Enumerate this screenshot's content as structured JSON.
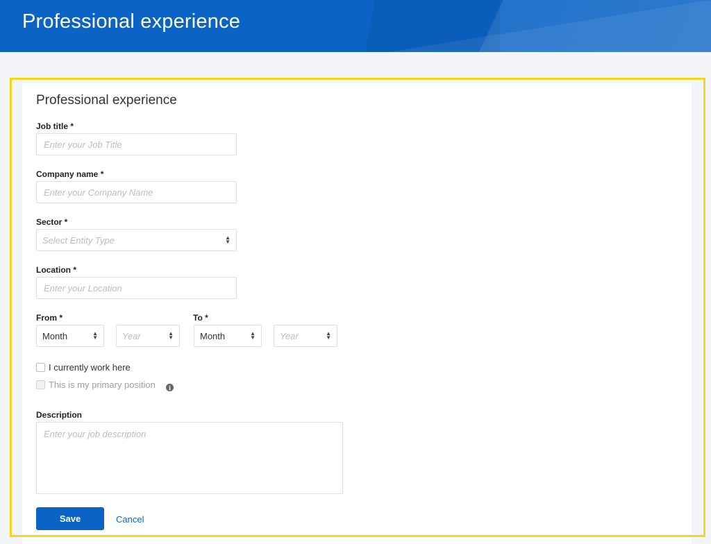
{
  "header": {
    "title": "Professional experience"
  },
  "form": {
    "title": "Professional experience",
    "job_title": {
      "label": "Job title *",
      "placeholder": "Enter your Job Title"
    },
    "company_name": {
      "label": "Company name *",
      "placeholder": "Enter your Company Name"
    },
    "sector": {
      "label": "Sector *",
      "placeholder": "Select Entity Type"
    },
    "location": {
      "label": "Location *",
      "placeholder": "Enter your Location"
    },
    "from": {
      "label": "From *",
      "month": "Month",
      "year_placeholder": "Year"
    },
    "to": {
      "label": "To *",
      "month": "Month",
      "year_placeholder": "Year"
    },
    "current_work": {
      "label": "I currently work here",
      "checked": false
    },
    "primary_position": {
      "label": "This is my primary position",
      "checked": false,
      "disabled": true
    },
    "description": {
      "label": "Description",
      "placeholder": "Enter your job description"
    },
    "save_label": "Save",
    "cancel_label": "Cancel"
  },
  "colors": {
    "brand_blue": "#0b63c5",
    "highlight": "#f7d619",
    "page_bg": "#f3f5f9"
  },
  "icons": {
    "select_caret": "up-down-caret-icon",
    "info": "info-icon"
  }
}
